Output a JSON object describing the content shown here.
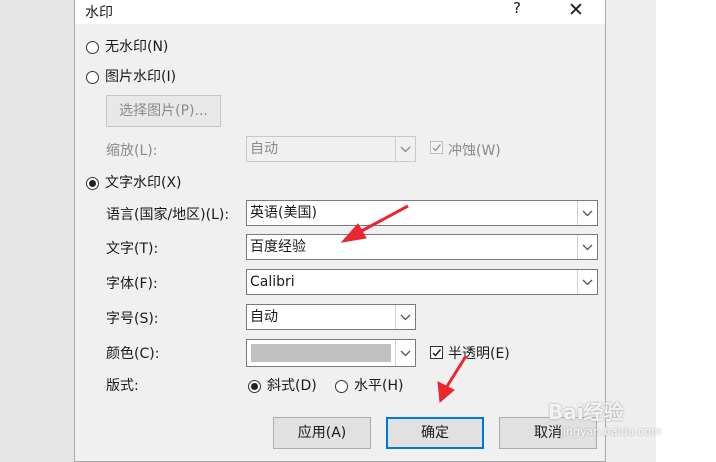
{
  "dialog": {
    "title": "水印",
    "help": "?",
    "close": "✕"
  },
  "no_watermark": {
    "label": "无水印(N)"
  },
  "picture_watermark": {
    "label": "图片水印(I)",
    "select_button": "选择图片(P)...",
    "scale_label": "缩放(L):",
    "scale_value": "自动",
    "washout_label": "冲蚀(W)"
  },
  "text_watermark": {
    "label": "文字水印(X)",
    "language_label": "语言(国家/地区)(L):",
    "language_value": "英语(美国)",
    "text_label": "文字(T):",
    "text_value": "百度经验",
    "font_label": "字体(F):",
    "font_value": "Calibri",
    "size_label": "字号(S):",
    "size_value": "自动",
    "color_label": "颜色(C):",
    "color_value": "#c0c0c0",
    "semitransparent_label": "半透明(E)",
    "layout_label": "版式:",
    "diagonal_label": "斜式(D)",
    "horizontal_label": "水平(H)"
  },
  "buttons": {
    "apply": "应用(A)",
    "ok": "确定",
    "cancel": "取消"
  },
  "watermark_overlay": {
    "logo": "Bai经验",
    "url": "jingyan.baidu.com"
  },
  "accent": "#e8272f"
}
